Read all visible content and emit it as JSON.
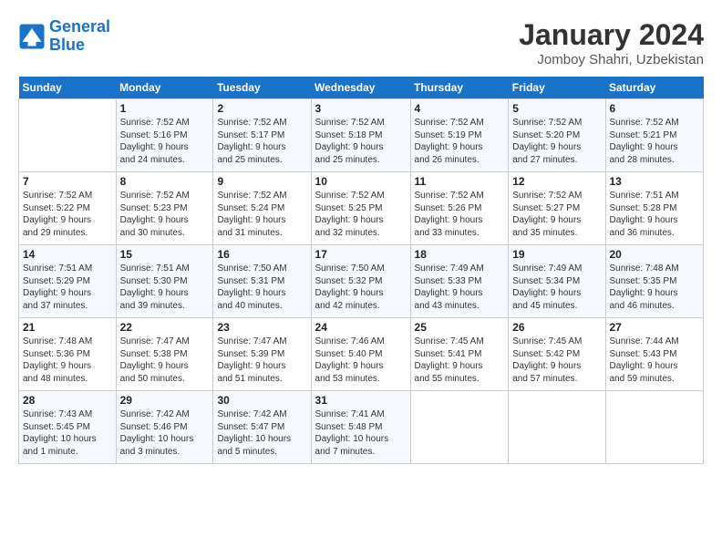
{
  "logo": {
    "line1": "General",
    "line2": "Blue"
  },
  "title": "January 2024",
  "subtitle": "Jomboy Shahri, Uzbekistan",
  "weekdays": [
    "Sunday",
    "Monday",
    "Tuesday",
    "Wednesday",
    "Thursday",
    "Friday",
    "Saturday"
  ],
  "weeks": [
    [
      {
        "day": "",
        "info": ""
      },
      {
        "day": "1",
        "info": "Sunrise: 7:52 AM\nSunset: 5:16 PM\nDaylight: 9 hours\nand 24 minutes."
      },
      {
        "day": "2",
        "info": "Sunrise: 7:52 AM\nSunset: 5:17 PM\nDaylight: 9 hours\nand 25 minutes."
      },
      {
        "day": "3",
        "info": "Sunrise: 7:52 AM\nSunset: 5:18 PM\nDaylight: 9 hours\nand 25 minutes."
      },
      {
        "day": "4",
        "info": "Sunrise: 7:52 AM\nSunset: 5:19 PM\nDaylight: 9 hours\nand 26 minutes."
      },
      {
        "day": "5",
        "info": "Sunrise: 7:52 AM\nSunset: 5:20 PM\nDaylight: 9 hours\nand 27 minutes."
      },
      {
        "day": "6",
        "info": "Sunrise: 7:52 AM\nSunset: 5:21 PM\nDaylight: 9 hours\nand 28 minutes."
      }
    ],
    [
      {
        "day": "7",
        "info": "Sunrise: 7:52 AM\nSunset: 5:22 PM\nDaylight: 9 hours\nand 29 minutes."
      },
      {
        "day": "8",
        "info": "Sunrise: 7:52 AM\nSunset: 5:23 PM\nDaylight: 9 hours\nand 30 minutes."
      },
      {
        "day": "9",
        "info": "Sunrise: 7:52 AM\nSunset: 5:24 PM\nDaylight: 9 hours\nand 31 minutes."
      },
      {
        "day": "10",
        "info": "Sunrise: 7:52 AM\nSunset: 5:25 PM\nDaylight: 9 hours\nand 32 minutes."
      },
      {
        "day": "11",
        "info": "Sunrise: 7:52 AM\nSunset: 5:26 PM\nDaylight: 9 hours\nand 33 minutes."
      },
      {
        "day": "12",
        "info": "Sunrise: 7:52 AM\nSunset: 5:27 PM\nDaylight: 9 hours\nand 35 minutes."
      },
      {
        "day": "13",
        "info": "Sunrise: 7:51 AM\nSunset: 5:28 PM\nDaylight: 9 hours\nand 36 minutes."
      }
    ],
    [
      {
        "day": "14",
        "info": "Sunrise: 7:51 AM\nSunset: 5:29 PM\nDaylight: 9 hours\nand 37 minutes."
      },
      {
        "day": "15",
        "info": "Sunrise: 7:51 AM\nSunset: 5:30 PM\nDaylight: 9 hours\nand 39 minutes."
      },
      {
        "day": "16",
        "info": "Sunrise: 7:50 AM\nSunset: 5:31 PM\nDaylight: 9 hours\nand 40 minutes."
      },
      {
        "day": "17",
        "info": "Sunrise: 7:50 AM\nSunset: 5:32 PM\nDaylight: 9 hours\nand 42 minutes."
      },
      {
        "day": "18",
        "info": "Sunrise: 7:49 AM\nSunset: 5:33 PM\nDaylight: 9 hours\nand 43 minutes."
      },
      {
        "day": "19",
        "info": "Sunrise: 7:49 AM\nSunset: 5:34 PM\nDaylight: 9 hours\nand 45 minutes."
      },
      {
        "day": "20",
        "info": "Sunrise: 7:48 AM\nSunset: 5:35 PM\nDaylight: 9 hours\nand 46 minutes."
      }
    ],
    [
      {
        "day": "21",
        "info": "Sunrise: 7:48 AM\nSunset: 5:36 PM\nDaylight: 9 hours\nand 48 minutes."
      },
      {
        "day": "22",
        "info": "Sunrise: 7:47 AM\nSunset: 5:38 PM\nDaylight: 9 hours\nand 50 minutes."
      },
      {
        "day": "23",
        "info": "Sunrise: 7:47 AM\nSunset: 5:39 PM\nDaylight: 9 hours\nand 51 minutes."
      },
      {
        "day": "24",
        "info": "Sunrise: 7:46 AM\nSunset: 5:40 PM\nDaylight: 9 hours\nand 53 minutes."
      },
      {
        "day": "25",
        "info": "Sunrise: 7:45 AM\nSunset: 5:41 PM\nDaylight: 9 hours\nand 55 minutes."
      },
      {
        "day": "26",
        "info": "Sunrise: 7:45 AM\nSunset: 5:42 PM\nDaylight: 9 hours\nand 57 minutes."
      },
      {
        "day": "27",
        "info": "Sunrise: 7:44 AM\nSunset: 5:43 PM\nDaylight: 9 hours\nand 59 minutes."
      }
    ],
    [
      {
        "day": "28",
        "info": "Sunrise: 7:43 AM\nSunset: 5:45 PM\nDaylight: 10 hours\nand 1 minute."
      },
      {
        "day": "29",
        "info": "Sunrise: 7:42 AM\nSunset: 5:46 PM\nDaylight: 10 hours\nand 3 minutes."
      },
      {
        "day": "30",
        "info": "Sunrise: 7:42 AM\nSunset: 5:47 PM\nDaylight: 10 hours\nand 5 minutes."
      },
      {
        "day": "31",
        "info": "Sunrise: 7:41 AM\nSunset: 5:48 PM\nDaylight: 10 hours\nand 7 minutes."
      },
      {
        "day": "",
        "info": ""
      },
      {
        "day": "",
        "info": ""
      },
      {
        "day": "",
        "info": ""
      }
    ]
  ]
}
